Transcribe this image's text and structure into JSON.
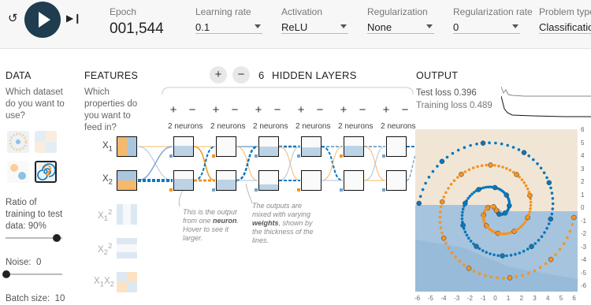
{
  "controls": {
    "epoch_label": "Epoch",
    "epoch_value": "001,544",
    "learning_rate_label": "Learning rate",
    "learning_rate_value": "0.1",
    "activation_label": "Activation",
    "activation_value": "ReLU",
    "regularization_label": "Regularization",
    "regularization_value": "None",
    "reg_rate_label": "Regularization rate",
    "reg_rate_value": "0",
    "problem_type_label": "Problem type",
    "problem_type_value": "Classification"
  },
  "data_panel": {
    "title": "DATA",
    "question": "Which dataset do you want to use?",
    "ratio_label": "Ratio of training to test data:",
    "ratio_value": "90%",
    "ratio_fraction": 0.9,
    "noise_label": "Noise:",
    "noise_value": "0",
    "batch_label": "Batch size:",
    "batch_value": "10"
  },
  "features": {
    "title": "FEATURES",
    "question": "Which properties do you want to feed in?",
    "items": [
      "X1",
      "X2",
      "X1²",
      "X2²",
      "X1X2"
    ]
  },
  "hidden": {
    "plus": "+",
    "minus": "−",
    "count": "6",
    "label": "HIDDEN LAYERS",
    "neuron_label": "2 neurons",
    "note1": {
      "pre": "This is the output from one ",
      "bold": "neuron",
      "post": ". Hover to see it larger."
    },
    "note2": {
      "pre": "The outputs are mixed with varying ",
      "bold": "weights",
      "post": ", shown by the thickness of the lines."
    }
  },
  "output": {
    "title": "OUTPUT",
    "test_loss_label": "Test loss",
    "test_loss_value": "0.396",
    "training_loss_label": "Training loss",
    "training_loss_value": "0.489",
    "axis_ticks": [
      "-6",
      "-5",
      "-4",
      "-3",
      "-2",
      "-1",
      "0",
      "1",
      "2",
      "3",
      "4",
      "5",
      "6"
    ],
    "y_ticks": [
      "6",
      "5",
      "4",
      "3",
      "2",
      "1",
      "0",
      "-1",
      "-2",
      "-3",
      "-4",
      "-5",
      "-6"
    ]
  },
  "colors": {
    "orange": "#f59322",
    "blue": "#0877bd",
    "dark": "#1f3d4f"
  }
}
